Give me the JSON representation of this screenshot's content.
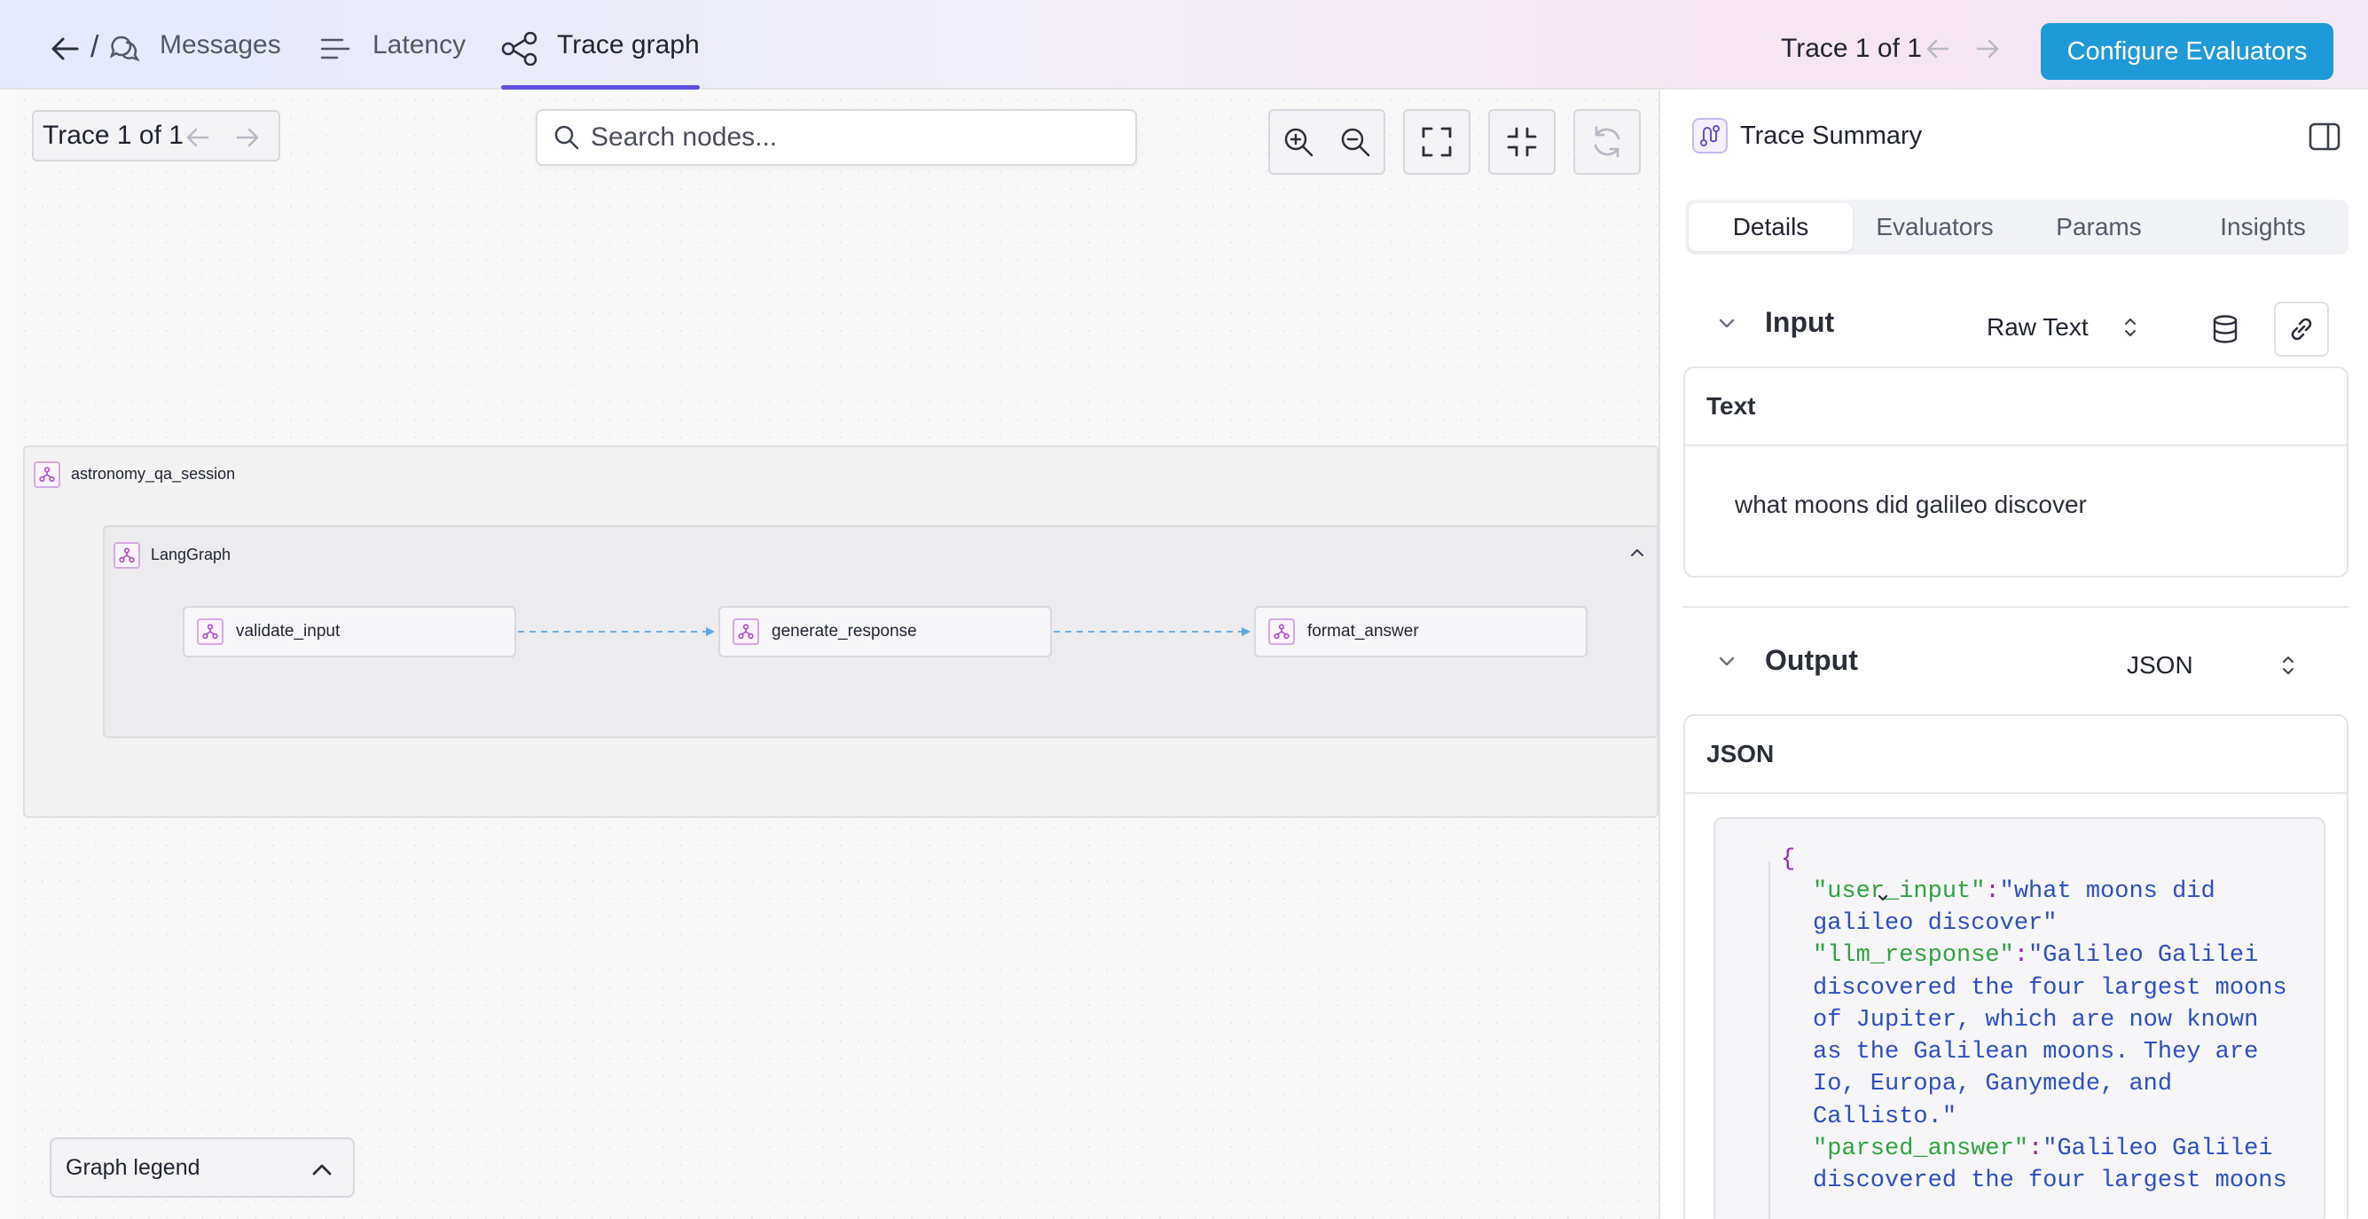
{
  "topbar": {
    "tabs": [
      {
        "label": "Messages",
        "icon": "messages-icon"
      },
      {
        "label": "Latency",
        "icon": "latency-icon"
      },
      {
        "label": "Trace graph",
        "icon": "trace-graph-icon",
        "active": true
      }
    ],
    "trace_counter": "Trace 1 of 1",
    "configure_label": "Configure Evaluators",
    "accent_color": "#1f9ad9",
    "tab_underline_color": "#5b4ee0"
  },
  "canvas": {
    "trace_counter": "Trace 1 of 1",
    "search_placeholder": "Search nodes...",
    "groups": {
      "session": "astronomy_qa_session",
      "graph": "LangGraph"
    },
    "nodes": [
      {
        "label": "validate_input"
      },
      {
        "label": "generate_response"
      },
      {
        "label": "format_answer"
      }
    ],
    "legend_label": "Graph legend"
  },
  "panel": {
    "title": "Trace Summary",
    "tabs": [
      {
        "label": "Details",
        "active": true
      },
      {
        "label": "Evaluators"
      },
      {
        "label": "Params"
      },
      {
        "label": "Insights"
      }
    ],
    "input": {
      "title": "Input",
      "format": "Raw Text",
      "card_header": "Text",
      "text": "what moons did galileo discover"
    },
    "output": {
      "title": "Output",
      "format": "JSON",
      "card_header": "JSON",
      "json_lines": {
        "open_brace": "{",
        "user_input_key": "\"user_input\"",
        "user_input_val_1": "\"what moons did",
        "user_input_val_2": "galileo discover\"",
        "llm_response_key": "\"llm_response\"",
        "llm_val_1": "\"Galileo Galilei",
        "llm_val_2": "discovered the four largest moons",
        "llm_val_3": "of Jupiter, which are now known",
        "llm_val_4": "as the Galilean moons. They are",
        "llm_val_5": "Io, Europa, Ganymede, and",
        "llm_val_6": "Callisto.\"",
        "parsed_answer_key": "\"parsed_answer\"",
        "parsed_val_1": "\"Galileo Galilei",
        "parsed_val_2": "discovered the four largest moons",
        "colon": ":"
      }
    }
  }
}
